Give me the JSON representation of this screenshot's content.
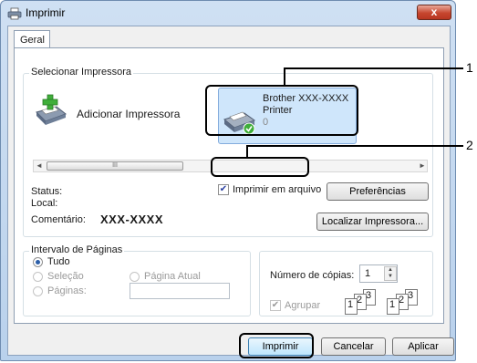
{
  "window": {
    "title": "Imprimir",
    "close_label": "x"
  },
  "tabs": [
    {
      "label": "Geral"
    }
  ],
  "select_printer": {
    "group_label": "Selecionar Impressora",
    "add_printer_label": "Adicionar Impressora",
    "selected_printer_line1": "Brother XXX-XXXX",
    "selected_printer_line2": "Printer",
    "selected_printer_count": "0",
    "scroll_grip": "III"
  },
  "status": {
    "status_label": "Status:",
    "location_label": "Local:",
    "comment_label": "Comentário:",
    "comment_value": "XXX-XXXX",
    "print_to_file_label": "Imprimir em arquivo",
    "print_to_file_checked": true,
    "preferences_button": "Preferências",
    "find_printer_button": "Localizar Impressora..."
  },
  "page_range": {
    "group_label": "Intervalo de Páginas",
    "all_label": "Tudo",
    "selection_label": "Seleção",
    "current_page_label": "Página Atual",
    "pages_label": "Páginas:",
    "pages_value": ""
  },
  "copies": {
    "label": "Número de cópias:",
    "value": "1",
    "collate_label": "Agrupar",
    "collate_checked": true,
    "collate_digits": [
      "1",
      "2",
      "3"
    ]
  },
  "buttons": {
    "print": "Imprimir",
    "cancel": "Cancelar",
    "apply": "Aplicar"
  },
  "callouts": [
    "1",
    "2"
  ],
  "colors": {
    "accent": "#cfe6fb",
    "close": "#c7462f"
  }
}
